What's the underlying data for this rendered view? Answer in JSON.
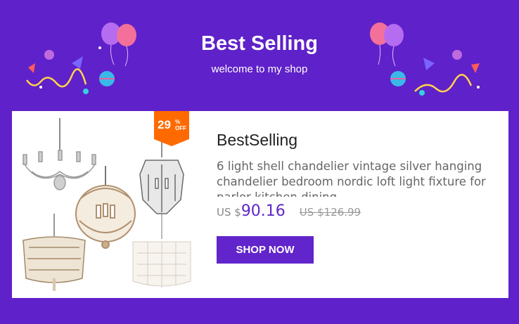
{
  "header": {
    "title": "Best Selling",
    "subtitle": "welcome to my shop"
  },
  "product": {
    "discount_value": "29",
    "discount_percent": "%",
    "discount_off": "OFF",
    "title": "BestSelling",
    "description": "6 light shell chandelier vintage silver hanging chandelier bedroom nordic loft light fixture for parlor kitchen dining",
    "currency": "US $",
    "price": "90.16",
    "old_price": "US $126.99",
    "button_label": "SHOP NOW"
  },
  "icons": {
    "left": "balloon-decoration-icon",
    "right": "balloon-decoration-icon",
    "product": "chandelier-product-image"
  },
  "colors": {
    "background": "#5f21c9",
    "button": "#6224cb",
    "badge": "#ff6a00",
    "price": "#6028c8"
  }
}
